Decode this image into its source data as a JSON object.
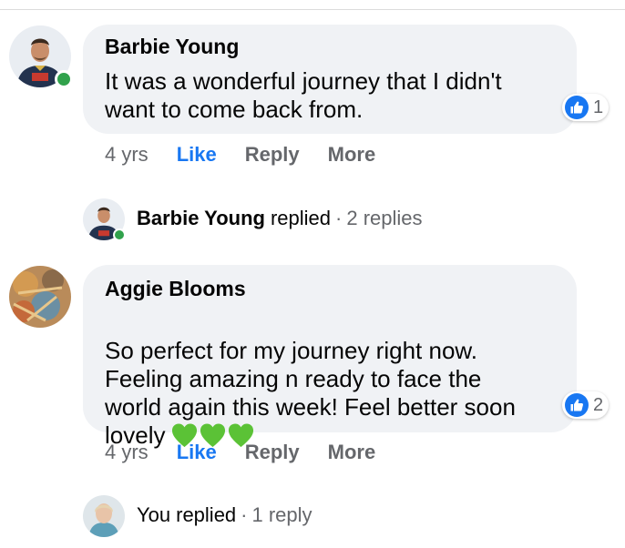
{
  "colors": {
    "like_blue": "#1877f2",
    "bubble_bg": "#f0f2f5",
    "muted_text": "#65676b",
    "online_green": "#31a24c",
    "heart_green": "#5bc236"
  },
  "comments": [
    {
      "author": "Barbie Young",
      "text": "It was a wonderful journey that I didn't\nwant to come back from.",
      "emoji": [],
      "reaction_icon": "thumbs-up-icon",
      "reaction_count": "1",
      "time": "4 yrs",
      "like_label": "Like",
      "reply_label": "Reply",
      "more_label": "More",
      "online": true,
      "replies": {
        "name": "Barbie Young",
        "action": "replied",
        "separator": "·",
        "count": "2 replies"
      }
    },
    {
      "author": "Aggie Blooms",
      "text": "So perfect for my journey right now.\nFeeling amazing n ready to face the\nworld again this week! Feel better soon\nlovely",
      "emoji": [
        "green-heart-icon",
        "green-heart-icon",
        "green-heart-icon"
      ],
      "reaction_icon": "thumbs-up-icon",
      "reaction_count": "2",
      "time": "4 yrs",
      "like_label": "Like",
      "reply_label": "Reply",
      "more_label": "More",
      "online": false,
      "replies": {
        "name": "You",
        "action": "replied",
        "separator": "·",
        "count": "1 reply"
      }
    }
  ]
}
